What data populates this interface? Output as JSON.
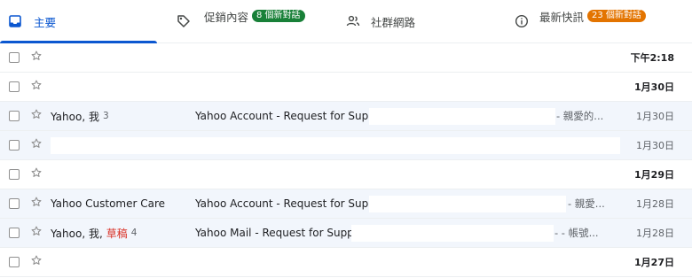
{
  "tabs": {
    "primary": {
      "label": "主要",
      "icon": "inbox-icon",
      "accent": "#0b57d0"
    },
    "promotions": {
      "label": "促銷內容",
      "badge": "8 個新對話",
      "badge_color": "#188038",
      "icon": "tag-icon"
    },
    "social": {
      "label": "社群網路",
      "icon": "people-icon"
    },
    "updates": {
      "label": "最新快訊",
      "badge": "23 個新對話",
      "badge_color": "#e37400",
      "icon": "info-icon"
    }
  },
  "rows": [
    {
      "sender": "",
      "subject": "",
      "snippet": "",
      "date": "下午2:18"
    },
    {
      "sender": "",
      "subject": "",
      "snippet": "",
      "date": "1月30日"
    },
    {
      "sender": "Yahoo, 我",
      "count": "3",
      "subject": "Yahoo Account - Request for Support",
      "snippet": "- 親愛的...",
      "date": "1月30日"
    },
    {
      "sender": "",
      "subject": "",
      "snippet": "",
      "date": "1月30日"
    },
    {
      "sender": "",
      "subject": "",
      "snippet": "",
      "date": "1月29日"
    },
    {
      "sender": "Yahoo Customer Care",
      "subject": "Yahoo Account - Request for Support",
      "snippet": "- 親愛...",
      "date": "1月28日"
    },
    {
      "sender": "Yahoo, 我,",
      "draft": "草稿",
      "count": "4",
      "subject": "Yahoo Mail - Request for Support",
      "snippet": "- - 帳號...",
      "date": "1月28日"
    },
    {
      "sender": "",
      "subject": "",
      "snippet": "",
      "date": "1月27日"
    }
  ]
}
